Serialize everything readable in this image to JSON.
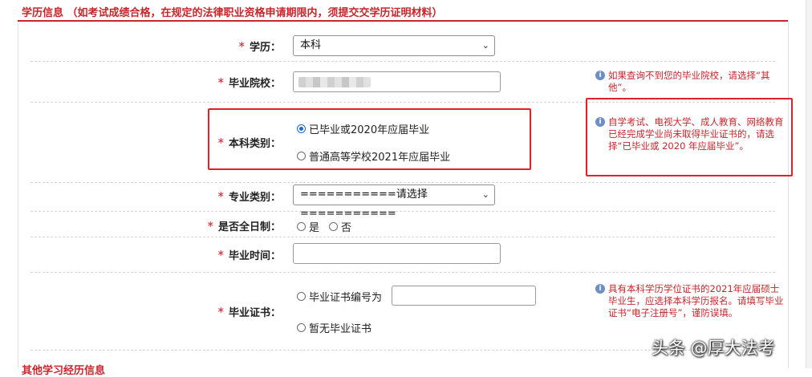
{
  "section": {
    "title": "学历信息 （如考试成绩合格，在规定的法律职业资格申请期限内，须提交交学历证明材料）",
    "next_section_partial": "其他学习经历信息"
  },
  "required_mark": "*",
  "fields": {
    "education": {
      "label": "学历：",
      "selected": "本科"
    },
    "school": {
      "label": "毕业院校：",
      "value": "",
      "note": "如果查询不到您的毕业院校，请选择“其他”。"
    },
    "category": {
      "label": "本科类别：",
      "options": [
        "已毕业或2020年应届毕业",
        "普通高等学校2021年应届毕业"
      ],
      "note": "自学考试、电视大学、成人教育、网络教育已经完成学业尚未取得毕业证书的，请选择“已毕业或 2020 年应届毕业”。"
    },
    "major": {
      "label": "专业类别：",
      "selected": "===========请选择==========="
    },
    "fulltime": {
      "label": "是否全日制：",
      "options": [
        "是",
        "否"
      ]
    },
    "grad_time": {
      "label": "毕业时间：",
      "value": ""
    },
    "certificate": {
      "label": "毕业证书：",
      "options": [
        "毕业证书编号为",
        "暂无毕业证书"
      ],
      "value": "",
      "note": "具有本科学历学位证书的2021年应届硕士毕业生，应选择本科学历报名。请填写毕业证书“电子注册号”，谨防误填。"
    }
  },
  "watermark": "头条 @厚大法考",
  "colors": {
    "accent": "#c8252b",
    "highlight": "#e0212a",
    "radio_checked": "#1a66d2"
  }
}
